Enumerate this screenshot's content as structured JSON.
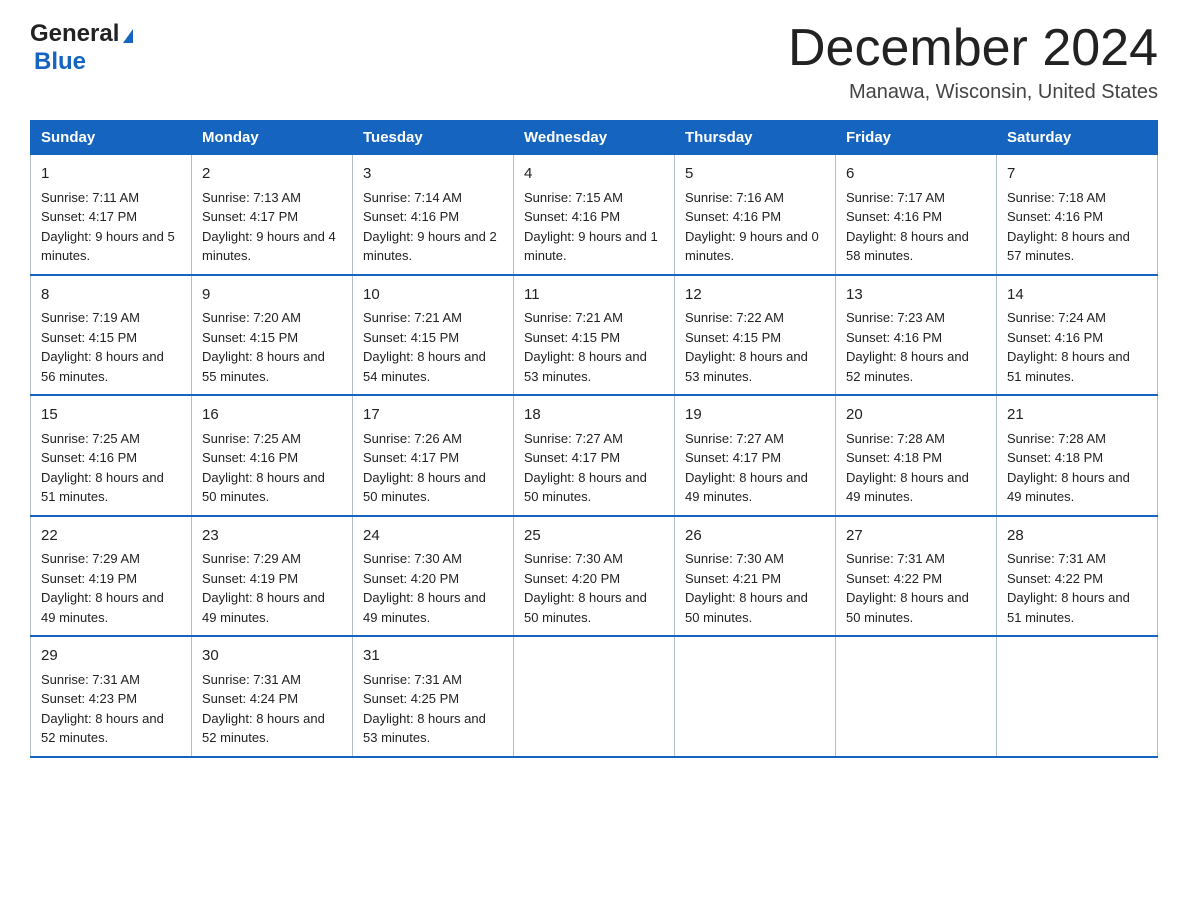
{
  "logo": {
    "general": "General",
    "blue": "Blue"
  },
  "title": "December 2024",
  "location": "Manawa, Wisconsin, United States",
  "days_of_week": [
    "Sunday",
    "Monday",
    "Tuesday",
    "Wednesday",
    "Thursday",
    "Friday",
    "Saturday"
  ],
  "weeks": [
    [
      {
        "day": "1",
        "sunrise": "7:11 AM",
        "sunset": "4:17 PM",
        "daylight": "9 hours and 5 minutes."
      },
      {
        "day": "2",
        "sunrise": "7:13 AM",
        "sunset": "4:17 PM",
        "daylight": "9 hours and 4 minutes."
      },
      {
        "day": "3",
        "sunrise": "7:14 AM",
        "sunset": "4:16 PM",
        "daylight": "9 hours and 2 minutes."
      },
      {
        "day": "4",
        "sunrise": "7:15 AM",
        "sunset": "4:16 PM",
        "daylight": "9 hours and 1 minute."
      },
      {
        "day": "5",
        "sunrise": "7:16 AM",
        "sunset": "4:16 PM",
        "daylight": "9 hours and 0 minutes."
      },
      {
        "day": "6",
        "sunrise": "7:17 AM",
        "sunset": "4:16 PM",
        "daylight": "8 hours and 58 minutes."
      },
      {
        "day": "7",
        "sunrise": "7:18 AM",
        "sunset": "4:16 PM",
        "daylight": "8 hours and 57 minutes."
      }
    ],
    [
      {
        "day": "8",
        "sunrise": "7:19 AM",
        "sunset": "4:15 PM",
        "daylight": "8 hours and 56 minutes."
      },
      {
        "day": "9",
        "sunrise": "7:20 AM",
        "sunset": "4:15 PM",
        "daylight": "8 hours and 55 minutes."
      },
      {
        "day": "10",
        "sunrise": "7:21 AM",
        "sunset": "4:15 PM",
        "daylight": "8 hours and 54 minutes."
      },
      {
        "day": "11",
        "sunrise": "7:21 AM",
        "sunset": "4:15 PM",
        "daylight": "8 hours and 53 minutes."
      },
      {
        "day": "12",
        "sunrise": "7:22 AM",
        "sunset": "4:15 PM",
        "daylight": "8 hours and 53 minutes."
      },
      {
        "day": "13",
        "sunrise": "7:23 AM",
        "sunset": "4:16 PM",
        "daylight": "8 hours and 52 minutes."
      },
      {
        "day": "14",
        "sunrise": "7:24 AM",
        "sunset": "4:16 PM",
        "daylight": "8 hours and 51 minutes."
      }
    ],
    [
      {
        "day": "15",
        "sunrise": "7:25 AM",
        "sunset": "4:16 PM",
        "daylight": "8 hours and 51 minutes."
      },
      {
        "day": "16",
        "sunrise": "7:25 AM",
        "sunset": "4:16 PM",
        "daylight": "8 hours and 50 minutes."
      },
      {
        "day": "17",
        "sunrise": "7:26 AM",
        "sunset": "4:17 PM",
        "daylight": "8 hours and 50 minutes."
      },
      {
        "day": "18",
        "sunrise": "7:27 AM",
        "sunset": "4:17 PM",
        "daylight": "8 hours and 50 minutes."
      },
      {
        "day": "19",
        "sunrise": "7:27 AM",
        "sunset": "4:17 PM",
        "daylight": "8 hours and 49 minutes."
      },
      {
        "day": "20",
        "sunrise": "7:28 AM",
        "sunset": "4:18 PM",
        "daylight": "8 hours and 49 minutes."
      },
      {
        "day": "21",
        "sunrise": "7:28 AM",
        "sunset": "4:18 PM",
        "daylight": "8 hours and 49 minutes."
      }
    ],
    [
      {
        "day": "22",
        "sunrise": "7:29 AM",
        "sunset": "4:19 PM",
        "daylight": "8 hours and 49 minutes."
      },
      {
        "day": "23",
        "sunrise": "7:29 AM",
        "sunset": "4:19 PM",
        "daylight": "8 hours and 49 minutes."
      },
      {
        "day": "24",
        "sunrise": "7:30 AM",
        "sunset": "4:20 PM",
        "daylight": "8 hours and 49 minutes."
      },
      {
        "day": "25",
        "sunrise": "7:30 AM",
        "sunset": "4:20 PM",
        "daylight": "8 hours and 50 minutes."
      },
      {
        "day": "26",
        "sunrise": "7:30 AM",
        "sunset": "4:21 PM",
        "daylight": "8 hours and 50 minutes."
      },
      {
        "day": "27",
        "sunrise": "7:31 AM",
        "sunset": "4:22 PM",
        "daylight": "8 hours and 50 minutes."
      },
      {
        "day": "28",
        "sunrise": "7:31 AM",
        "sunset": "4:22 PM",
        "daylight": "8 hours and 51 minutes."
      }
    ],
    [
      {
        "day": "29",
        "sunrise": "7:31 AM",
        "sunset": "4:23 PM",
        "daylight": "8 hours and 52 minutes."
      },
      {
        "day": "30",
        "sunrise": "7:31 AM",
        "sunset": "4:24 PM",
        "daylight": "8 hours and 52 minutes."
      },
      {
        "day": "31",
        "sunrise": "7:31 AM",
        "sunset": "4:25 PM",
        "daylight": "8 hours and 53 minutes."
      },
      null,
      null,
      null,
      null
    ]
  ],
  "labels": {
    "sunrise": "Sunrise:",
    "sunset": "Sunset:",
    "daylight": "Daylight:"
  }
}
